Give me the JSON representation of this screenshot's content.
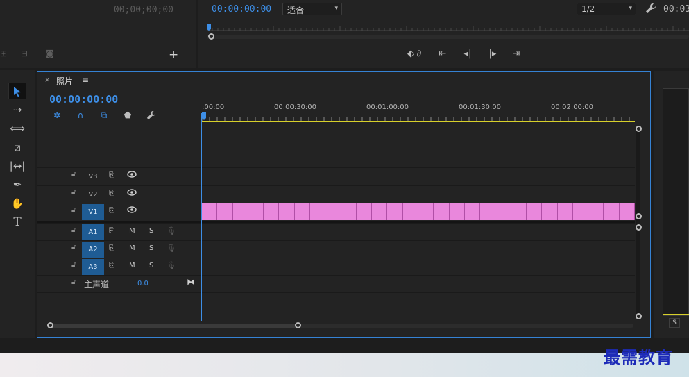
{
  "source_panel": {
    "timecode": "00;00;00;00"
  },
  "program_monitor": {
    "timecode": "00:00:00:00",
    "fit_dropdown": "适合",
    "resolution_dropdown": "1/2",
    "duration_partial": "00:03"
  },
  "tools": [
    {
      "name": "selection-tool",
      "active": true
    },
    {
      "name": "track-select-tool"
    },
    {
      "name": "ripple-edit-tool"
    },
    {
      "name": "razor-tool"
    },
    {
      "name": "slip-tool"
    },
    {
      "name": "pen-tool"
    },
    {
      "name": "hand-tool"
    },
    {
      "name": "type-tool"
    }
  ],
  "timeline": {
    "tab_close": "×",
    "tab_title": "照片",
    "tab_menu": "≡",
    "timecode": "00:00:00:00",
    "ruler_labels": [
      ":00:00",
      "00:00:30:00",
      "00:01:00:00",
      "00:01:30:00",
      "00:02:00:00"
    ],
    "video_tracks": [
      {
        "name": "V3",
        "targeted": false
      },
      {
        "name": "V2",
        "targeted": false
      },
      {
        "name": "V1",
        "targeted": true
      }
    ],
    "audio_tracks": [
      {
        "name": "A1",
        "m": "M",
        "s": "S"
      },
      {
        "name": "A2",
        "m": "M",
        "s": "S"
      },
      {
        "name": "A3",
        "m": "M",
        "s": "S"
      }
    ],
    "master": {
      "label": "主声道",
      "value": "0.0"
    },
    "clip_color": "#e987dc",
    "clip_cells": 28
  },
  "meter": {
    "solo_label": "S"
  },
  "watermark": "最需教育",
  "colors": {
    "accent": "#3d8ee6",
    "panel_border": "#3582d4",
    "track_target": "#1f5c94"
  }
}
